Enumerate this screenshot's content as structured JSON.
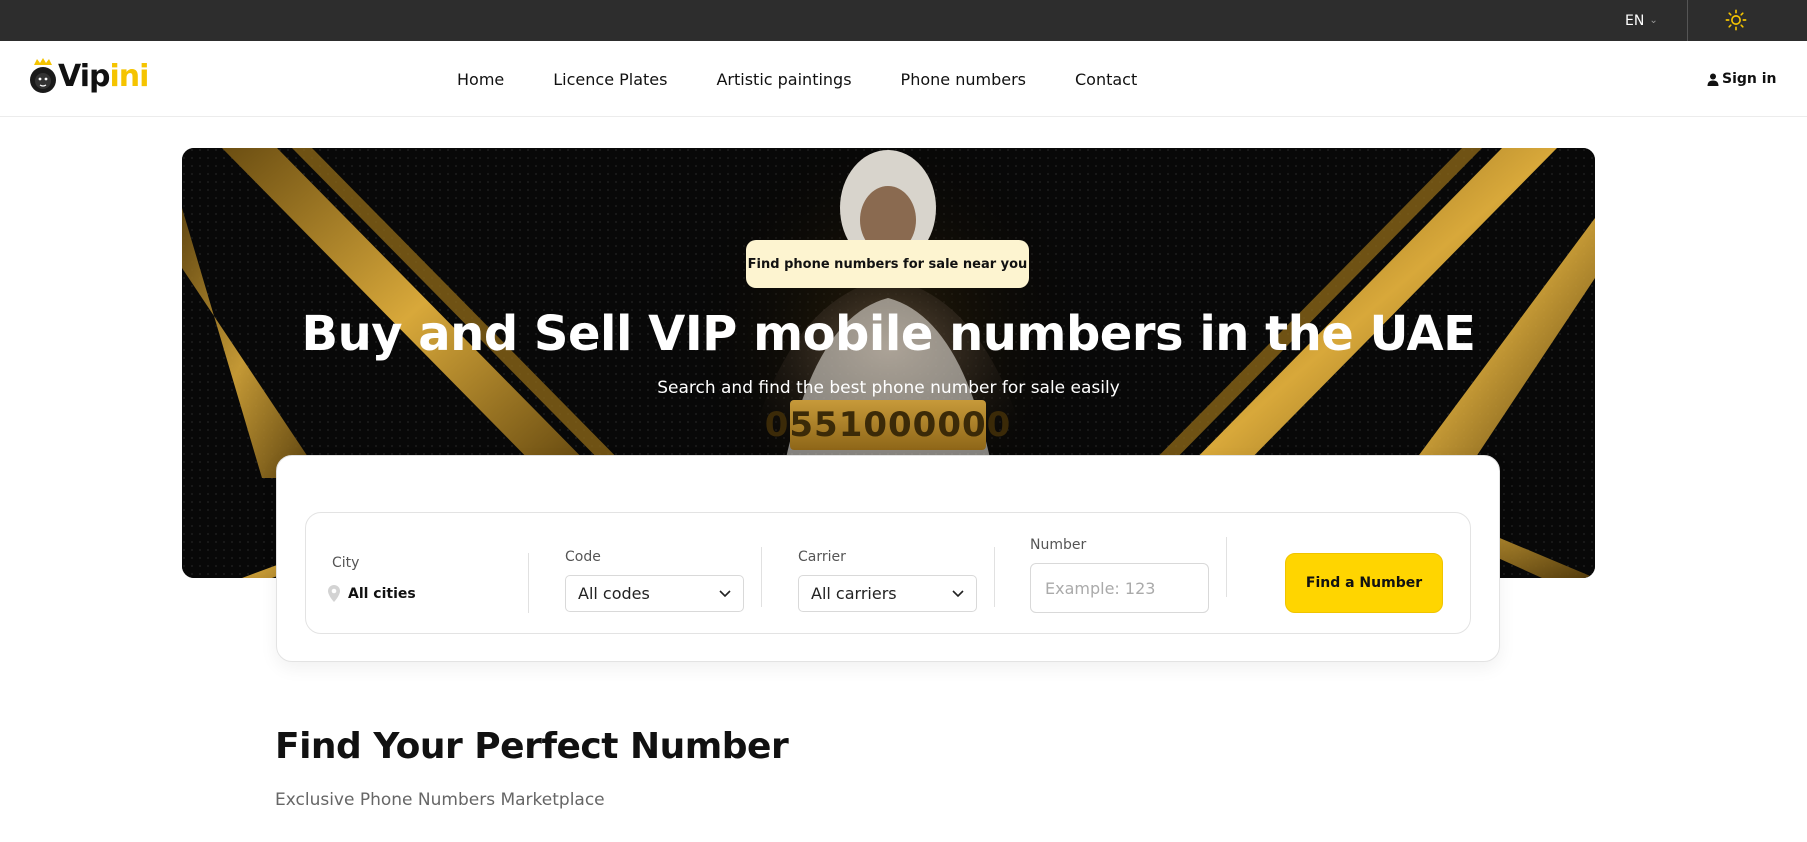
{
  "topbar": {
    "language": "EN",
    "language_chevron_icon": "chevron-down-icon",
    "theme_icon": "sun-icon",
    "accent_color": "#f5c400"
  },
  "header": {
    "logo": {
      "part1": "Vip",
      "part2": "ini",
      "icon": "lion-crown-icon"
    },
    "nav": [
      {
        "label": "Home"
      },
      {
        "label": "Licence Plates"
      },
      {
        "label": "Artistic paintings"
      },
      {
        "label": "Phone numbers"
      },
      {
        "label": "Contact"
      }
    ],
    "signin_label": "Sign in",
    "signin_icon": "user-icon"
  },
  "hero": {
    "badge": "Find phone numbers for sale near you",
    "title": "Buy and Sell VIP mobile numbers in the UAE",
    "subtitle": "Search and find the best phone number for sale easily",
    "plate_number": "0551000000",
    "gold_color": "#c79a3a"
  },
  "search": {
    "city": {
      "label": "City",
      "value": "All cities",
      "icon": "location-pin-icon"
    },
    "code": {
      "label": "Code",
      "value": "All codes"
    },
    "carrier": {
      "label": "Carrier",
      "value": "All carriers"
    },
    "number": {
      "label": "Number",
      "placeholder": "Example: 123"
    },
    "button_label": "Find a Number",
    "button_color": "#ffd500"
  },
  "section": {
    "title": "Find Your Perfect Number",
    "subtitle": "Exclusive Phone Numbers Marketplace"
  }
}
